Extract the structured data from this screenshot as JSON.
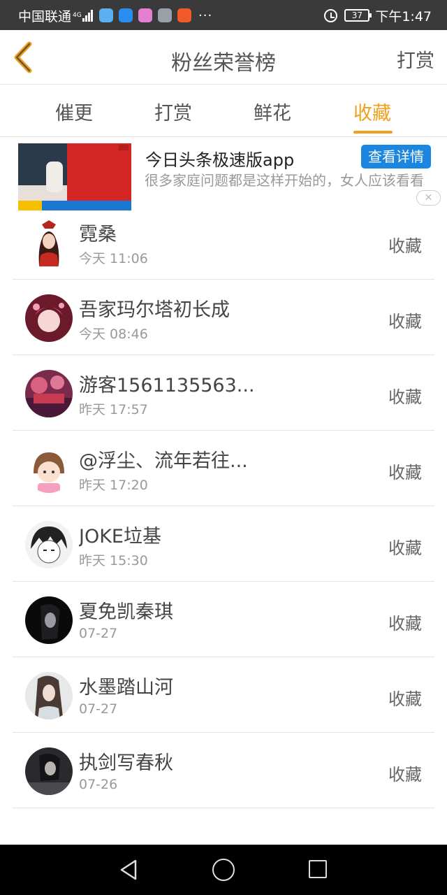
{
  "status_bar": {
    "carrier": "中国联通",
    "network": "4G",
    "time": "下午1:47",
    "battery": "37"
  },
  "header": {
    "title": "粉丝荣誉榜",
    "action_label": "打赏"
  },
  "tabs": [
    {
      "label": "催更",
      "active": false
    },
    {
      "label": "打赏",
      "active": false
    },
    {
      "label": "鲜花",
      "active": false
    },
    {
      "label": "收藏",
      "active": true
    }
  ],
  "ad": {
    "title": "今日头条极速版app",
    "cta_label": "查看详情",
    "description": "很多家庭问题都是这样开始的，女人应该看看",
    "close_symbol": "✕"
  },
  "list": [
    {
      "name": "霓桑",
      "time": "今天 11:06",
      "action": "收藏"
    },
    {
      "name": "吾家玛尔塔初长成",
      "time": "今天 08:46",
      "action": "收藏"
    },
    {
      "name": "游客1561135563...",
      "time": "昨天 17:57",
      "action": "收藏"
    },
    {
      "name": "@浮尘、流年若往...",
      "time": "昨天 17:20",
      "action": "收藏"
    },
    {
      "name": "JOKE垃基",
      "time": "昨天 15:30",
      "action": "收藏"
    },
    {
      "name": "夏免凯秦琪",
      "time": "07-27",
      "action": "收藏"
    },
    {
      "name": "水墨踏山河",
      "time": "07-27",
      "action": "收藏"
    },
    {
      "name": "执剑写春秋",
      "time": "07-26",
      "action": "收藏"
    }
  ],
  "colors": {
    "accent": "#f0a020",
    "ad_button": "#1a86e0",
    "status_bar": "#3a3a3a"
  }
}
